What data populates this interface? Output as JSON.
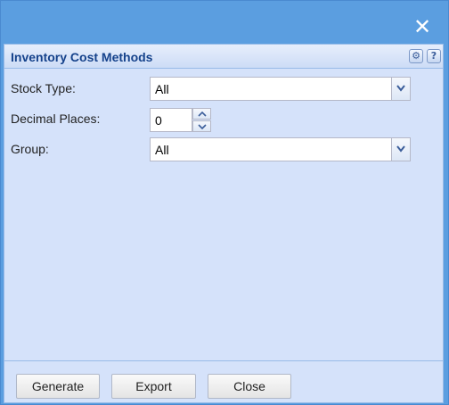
{
  "window": {
    "close_icon": "close-icon"
  },
  "panel": {
    "title": "Inventory Cost Methods",
    "tools": [
      "gear-icon",
      "help-icon"
    ],
    "help_glyph": "?"
  },
  "fields": {
    "stock_type": {
      "label": "Stock Type:",
      "value": "All"
    },
    "decimal_places": {
      "label": "Decimal Places:",
      "value": "0"
    },
    "group": {
      "label": "Group:",
      "value": "All"
    }
  },
  "footer": {
    "generate_label": "Generate",
    "export_label": "Export",
    "close_label": "Close"
  },
  "colors": {
    "titlebar": "#5b9ee0",
    "panel_bg": "#d5e2fa",
    "title_text": "#15428b"
  }
}
